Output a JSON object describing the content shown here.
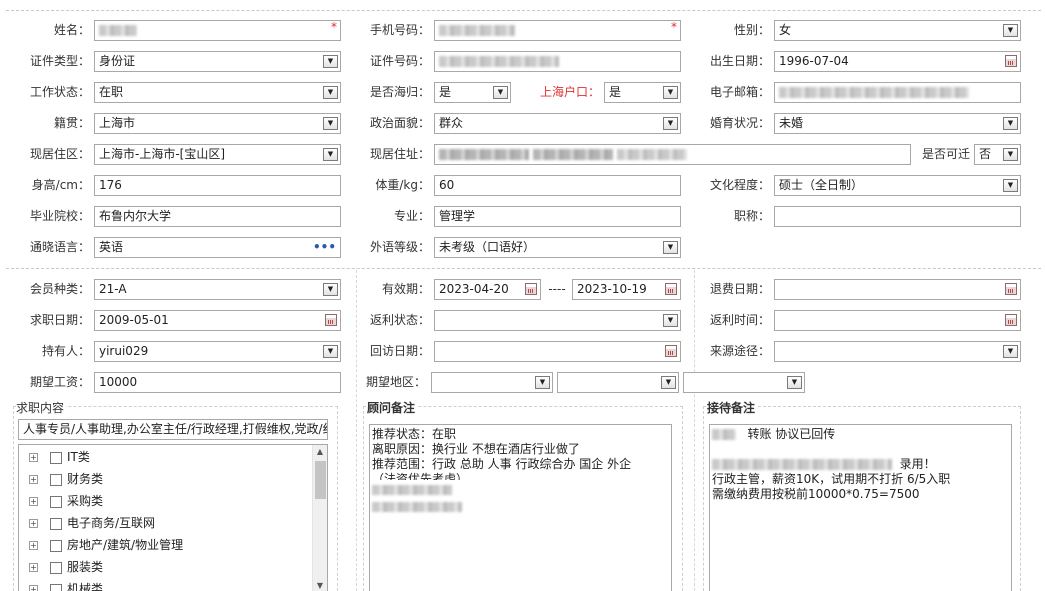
{
  "profile": {
    "name_label": "姓名：",
    "name_value": "",
    "mobile_label": "手机号码：",
    "gender_label": "性别：",
    "gender_value": "女",
    "id_type_label": "证件类型：",
    "id_type_value": "身份证",
    "id_number_label": "证件号码：",
    "birth_label": "出生日期：",
    "birth_value": "1996-07-04",
    "work_status_label": "工作状态：",
    "work_status_value": "在职",
    "returnee_label": "是否海归：",
    "returnee_value": "是",
    "shanghai_hukou_label": "上海户口：",
    "shanghai_hukou_value": "是",
    "email_label": "电子邮箱：",
    "native_label": "籍贯：",
    "native_value": "上海市",
    "political_label": "政治面貌：",
    "political_value": "群众",
    "marital_label": "婚育状况：",
    "marital_value": "未婚",
    "current_area_label": "现居住区：",
    "current_area_value": "上海市-上海市-[宝山区]",
    "current_address_label": "现居住址：",
    "relocate_label": "是否可迁",
    "relocate_value": "否",
    "height_label": "身高/cm：",
    "height_value": "176",
    "weight_label": "体重/kg：",
    "weight_value": "60",
    "education_label": "文化程度：",
    "education_value": "硕士（全日制）",
    "school_label": "毕业院校：",
    "school_value": "布鲁内尔大学",
    "major_label": "专业：",
    "major_value": "管理学",
    "title_label": "职称：",
    "title_value": "",
    "languages_label": "通晓语言：",
    "languages_value": "英语",
    "foreign_level_label": "外语等级：",
    "foreign_level_value": "未考级（口语好）"
  },
  "membership": {
    "member_type_label": "会员种类：",
    "member_type_value": "21-A",
    "valid_label": "有效期：",
    "valid_from": "2023-04-20",
    "valid_sep": "----",
    "valid_to": "2023-10-19",
    "refund_date_label": "退费日期：",
    "job_seek_date_label": "求职日期：",
    "job_seek_date_value": "2009-05-01",
    "rebate_status_label": "返利状态：",
    "rebate_time_label": "返利时间：",
    "holder_label": "持有人：",
    "holder_value": "yirui029",
    "visit_date_label": "回访日期：",
    "source_label": "来源途径：",
    "salary_label": "期望工资：",
    "salary_value": "10000",
    "region_label": "期望地区："
  },
  "job_content": {
    "legend": "求职内容",
    "selected_text": "人事专员/人事助理,办公室主任/行政经理,打假维权,党政/纪",
    "tree_items": [
      "IT类",
      "财务类",
      "采购类",
      "电子商务/互联网",
      "房地产/建筑/物业管理",
      "服装类",
      "机械类"
    ],
    "expand_symbol": "+"
  },
  "consultant_note": {
    "legend": "顾问备注",
    "lines": [
      "推荐状态：在职",
      "离职原因：换行业 不想在酒店行业做了",
      "推荐范围：行政 总助 人事 行政综合办  国企 外企",
      "（法资优先考虑）"
    ]
  },
  "reception_note": {
    "legend": "接待备注",
    "line1_visible": "转账  协议已回传",
    "line2_visible": "录用！",
    "line3": "行政主管，薪资10K，试用期不打折 6/5入职",
    "line4": "需缴纳费用按税前10000*0.75=7500"
  },
  "icons": {
    "dropdown": "▼",
    "required": "*",
    "more": "•••",
    "scroll_up": "▲",
    "scroll_down": "▼"
  },
  "colors": {
    "required": "#e03030",
    "hukou_label": "#e03030",
    "more_dots": "#2a5aa8"
  }
}
